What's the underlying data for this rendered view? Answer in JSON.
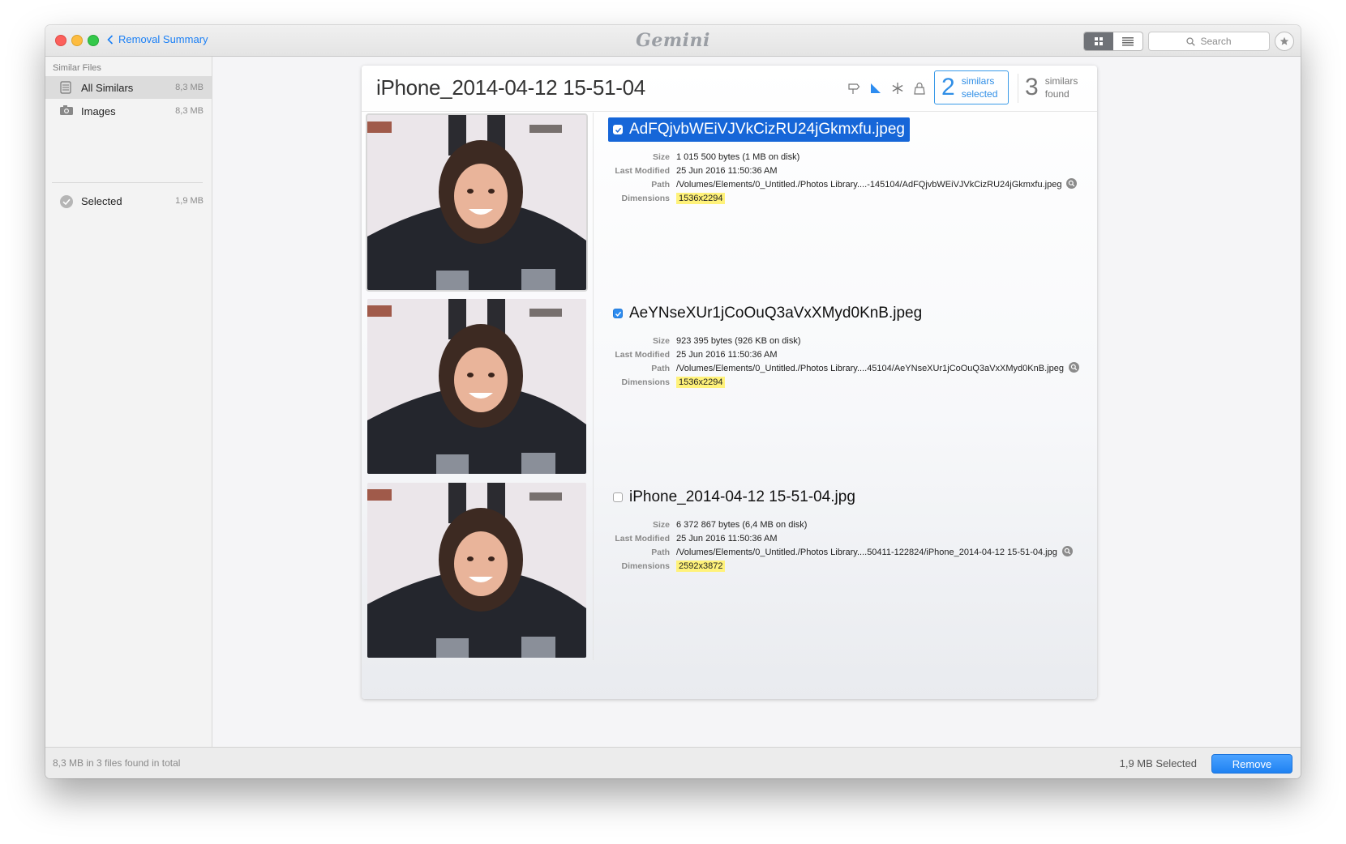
{
  "window": {
    "back_label": "Removal Summary",
    "app_title": "Gemini",
    "search_placeholder": "Search"
  },
  "sidebar": {
    "heading": "Similar Files",
    "items": [
      {
        "label": "All Similars",
        "size": "8,3 MB",
        "icon": "stack-icon",
        "active": true
      },
      {
        "label": "Images",
        "size": "8,3 MB",
        "icon": "camera-icon",
        "active": false
      },
      {
        "label": "Selected",
        "size": "1,9 MB",
        "icon": "checkmark-circle-icon",
        "active": false
      }
    ]
  },
  "group": {
    "title": "iPhone_2014-04-12 15-51-04",
    "tools": [
      "location-icon",
      "ruler-triangle-icon",
      "sparkle-icon",
      "lock-icon"
    ],
    "selected_count": "2",
    "selected_words": [
      "similars",
      "selected"
    ],
    "found_count": "3",
    "found_words": [
      "similars",
      "found"
    ]
  },
  "labels": {
    "size": "Size",
    "modified": "Last Modified",
    "path": "Path",
    "dimensions": "Dimensions"
  },
  "files": [
    {
      "name": "AdFQjvbWEiVJVkCizRU24jGkmxfu.jpeg",
      "checked": true,
      "highlighted": true,
      "size": "1 015 500 bytes (1 MB on disk)",
      "modified": "25 Jun 2016 11:50:36 AM",
      "path": "/Volumes/Elements/0_Untitled./Photos Library....-145104/AdFQjvbWEiVJVkCizRU24jGkmxfu.jpeg",
      "dimensions": "1536x2294"
    },
    {
      "name": "AeYNseXUr1jCoOuQ3aVxXMyd0KnB.jpeg",
      "checked": true,
      "highlighted": false,
      "size": "923 395 bytes (926 KB on disk)",
      "modified": "25 Jun 2016 11:50:36 AM",
      "path": "/Volumes/Elements/0_Untitled./Photos Library....45104/AeYNseXUr1jCoOuQ3aVxXMyd0KnB.jpeg",
      "dimensions": "1536x2294"
    },
    {
      "name": "iPhone_2014-04-12 15-51-04.jpg",
      "checked": false,
      "highlighted": false,
      "size": "6 372 867 bytes (6,4 MB on disk)",
      "modified": "25 Jun 2016 11:50:36 AM",
      "path": "/Volumes/Elements/0_Untitled./Photos Library....50411-122824/iPhone_2014-04-12 15-51-04.jpg",
      "dimensions": "2592x3872"
    }
  ],
  "footer": {
    "summary": "8,3 MB in 3 files found in total",
    "selected_total": "1,9 MB Selected",
    "remove_label": "Remove"
  },
  "colors": {
    "accent": "#2d8cf0",
    "highlight_row": "#1666d8",
    "dimension_highlight": "#fff27a"
  }
}
